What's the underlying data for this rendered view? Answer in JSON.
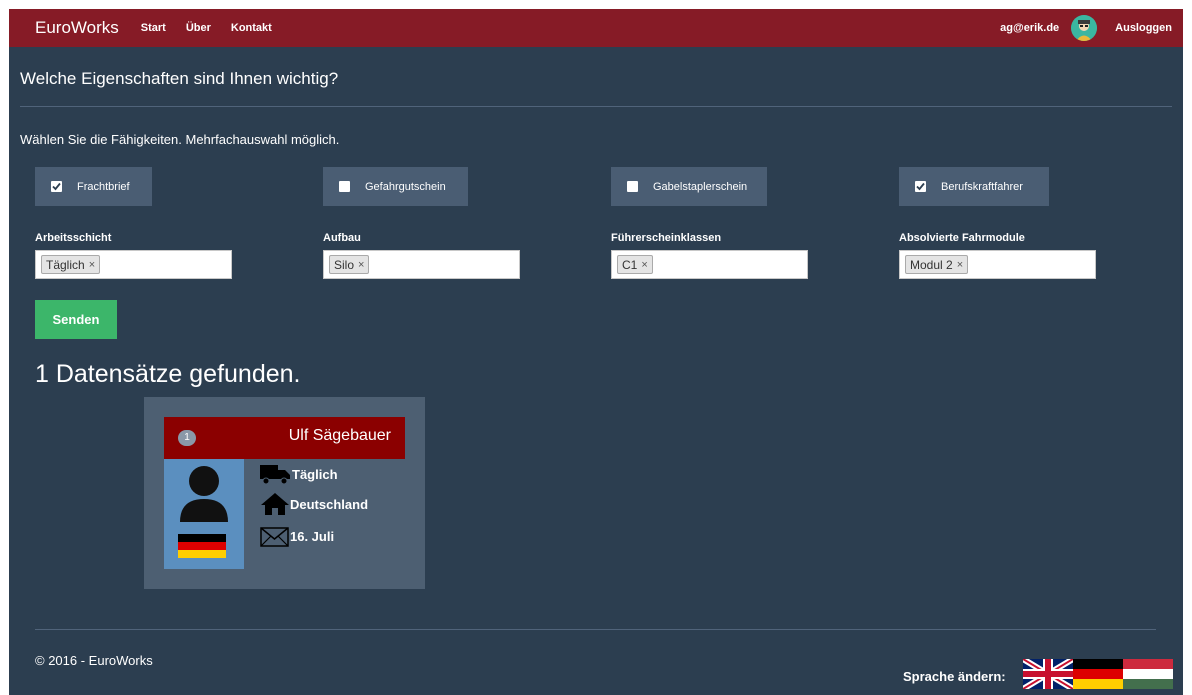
{
  "navbar": {
    "brand": "EuroWorks",
    "links": [
      "Start",
      "Über",
      "Kontakt"
    ],
    "user_email": "ag@erik.de",
    "logout": "Ausloggen"
  },
  "main": {
    "title": "Welche Eigenschaften sind Ihnen wichtig?",
    "subtitle": "Wählen Sie die Fähigkeiten. Mehrfachauswahl möglich.",
    "skills": [
      {
        "label": "Frachtbrief",
        "checked": true
      },
      {
        "label": "Gefahrgutschein",
        "checked": false
      },
      {
        "label": "Gabelstaplerschein",
        "checked": false
      },
      {
        "label": "Berufskraftfahrer",
        "checked": true
      }
    ],
    "filters": [
      {
        "label": "Arbeitsschicht",
        "tag": "Täglich"
      },
      {
        "label": "Aufbau",
        "tag": "Silo"
      },
      {
        "label": "Führerscheinklassen",
        "tag": "C1"
      },
      {
        "label": "Absolvierte Fahrmodule",
        "tag": "Modul 2"
      }
    ],
    "tag_remove": "×",
    "send_button": "Senden",
    "results_text": "1 Datensätze gefunden."
  },
  "result_card": {
    "index": "1",
    "name": "Ulf Sägebauer",
    "shift": "Täglich",
    "country": "Deutschland",
    "date": "16. Juli"
  },
  "footer": {
    "copyright": "© 2016 - EuroWorks",
    "language_label": "Sprache ändern:"
  },
  "colors": {
    "navbar": "#861b26",
    "background": "#2c3e50",
    "card_header": "#8b0000",
    "send_button": "#3cb66a"
  }
}
